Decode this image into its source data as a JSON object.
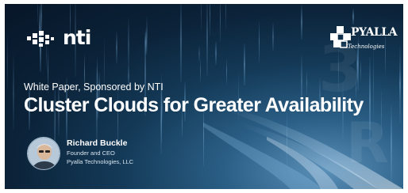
{
  "banner": {
    "sponsor_logo_text": "nti",
    "partner_logo_name": "PYALLA",
    "partner_logo_sub": "Technologies",
    "eyebrow": "White Paper, Sponsored by NTI",
    "headline": "Cluster Clouds for Greater Availability",
    "author": {
      "name": "Richard Buckle",
      "role": "Founder and CEO",
      "org": "Pyalla Technologies, LLC"
    }
  },
  "colors": {
    "background": "#0b2238",
    "accent_light": "#5a8fb8",
    "text": "#ffffff"
  },
  "icons": [
    "nti-logo-mark-icon",
    "pyalla-logo-mark-icon"
  ]
}
